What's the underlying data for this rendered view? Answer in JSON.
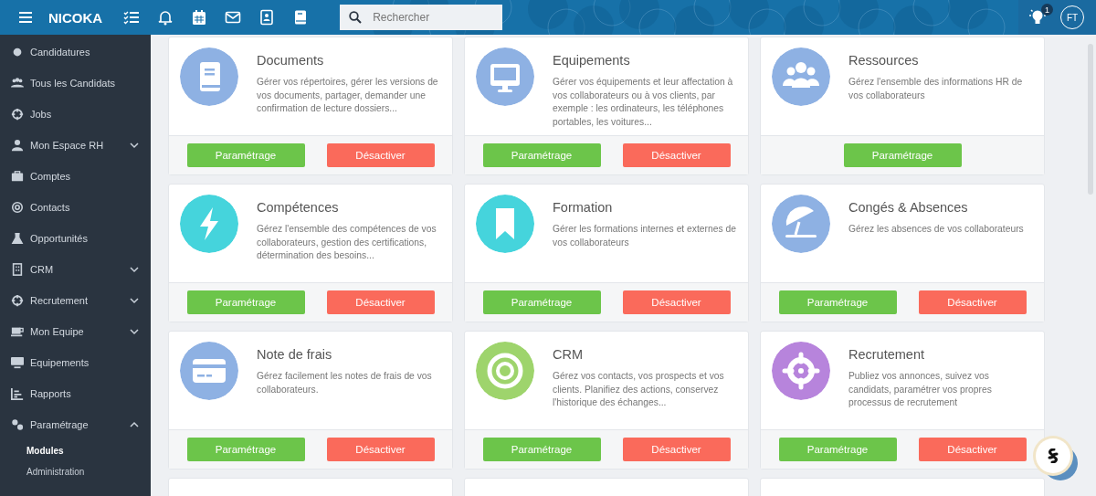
{
  "topbar": {
    "brand": "NICOKA",
    "search": {
      "placeholder": "Rechercher"
    },
    "notification_badge": "1",
    "avatar": "FT"
  },
  "sidebar": {
    "items": [
      {
        "label": "Candidatures",
        "selected": false
      },
      {
        "label": "Tous les Candidats",
        "selected": false
      },
      {
        "label": "Jobs",
        "selected": false
      },
      {
        "label": "Mon Espace RH",
        "selected": false,
        "expanded": false
      },
      {
        "label": "Comptes",
        "selected": false
      },
      {
        "label": "Contacts",
        "selected": false
      },
      {
        "label": "Opportunités",
        "selected": false
      },
      {
        "label": "CRM",
        "selected": false,
        "expanded": false
      },
      {
        "label": "Recrutement",
        "selected": false,
        "expanded": false
      },
      {
        "label": "Mon Equipe",
        "selected": false,
        "expanded": false
      },
      {
        "label": "Equipements",
        "selected": false
      },
      {
        "label": "Rapports",
        "selected": false
      },
      {
        "label": "Paramétrage",
        "selected": false,
        "expanded": true,
        "children": [
          {
            "label": "Modules",
            "selected": true
          },
          {
            "label": "Administration",
            "selected": false
          }
        ]
      }
    ]
  },
  "modules": [
    {
      "title": "Documents",
      "color": "#8eb1e3",
      "description": "Gérer vos répertoires, gérer les versions de vos documents, partager, demander une confirmation de lecture dossiers...",
      "buttons": [
        {
          "label": "Paramétrage",
          "kind": "settings"
        },
        {
          "label": "Désactiver",
          "kind": "deactivate"
        }
      ]
    },
    {
      "title": "Equipements",
      "color": "#8eb1e3",
      "description": "Gérer vos équipements et leur affectation à vos collaborateurs ou à vos clients, par exemple : les ordinateurs, les téléphones portables, les voitures...",
      "buttons": [
        {
          "label": "Paramétrage",
          "kind": "settings"
        },
        {
          "label": "Désactiver",
          "kind": "deactivate"
        }
      ]
    },
    {
      "title": "Ressources",
      "color": "#8eb1e3",
      "description": "Gérez l'ensemble des informations HR de vos collaborateurs",
      "buttons": [
        {
          "label": "Paramétrage",
          "kind": "settings"
        }
      ]
    },
    {
      "title": "Compétences",
      "color": "#45d4dc",
      "description": "Gérez l'ensemble des compétences de vos collaborateurs, gestion des certifications, détermination des besoins...",
      "buttons": [
        {
          "label": "Paramétrage",
          "kind": "settings"
        },
        {
          "label": "Désactiver",
          "kind": "deactivate"
        }
      ]
    },
    {
      "title": "Formation",
      "color": "#45d4dc",
      "description": "Gérer les formations internes et externes de vos collaborateurs",
      "buttons": [
        {
          "label": "Paramétrage",
          "kind": "settings"
        },
        {
          "label": "Désactiver",
          "kind": "deactivate"
        }
      ]
    },
    {
      "title": "Congés & Absences",
      "color": "#8eb1e3",
      "description": "Gérez les absences de vos collaborateurs",
      "buttons": [
        {
          "label": "Paramétrage",
          "kind": "settings"
        },
        {
          "label": "Désactiver",
          "kind": "deactivate"
        }
      ]
    },
    {
      "title": "Note de frais",
      "color": "#8eb1e3",
      "description": "Gérez facilement les notes de frais de vos collaborateurs.",
      "buttons": [
        {
          "label": "Paramétrage",
          "kind": "settings"
        },
        {
          "label": "Désactiver",
          "kind": "deactivate"
        }
      ]
    },
    {
      "title": "CRM",
      "color": "#9ed46c",
      "description": "Gérez vos contacts, vos prospects et vos clients. Planifiez des actions, conservez l'historique des échanges...",
      "buttons": [
        {
          "label": "Paramétrage",
          "kind": "settings"
        },
        {
          "label": "Désactiver",
          "kind": "deactivate"
        }
      ]
    },
    {
      "title": "Recrutement",
      "color": "#b784dc",
      "description": "Publiez vos annonces, suivez vos candidats, paramétrer vos propres processus de recrutement",
      "buttons": [
        {
          "label": "Paramétrage",
          "kind": "settings"
        },
        {
          "label": "Désactiver",
          "kind": "deactivate"
        }
      ]
    }
  ]
}
